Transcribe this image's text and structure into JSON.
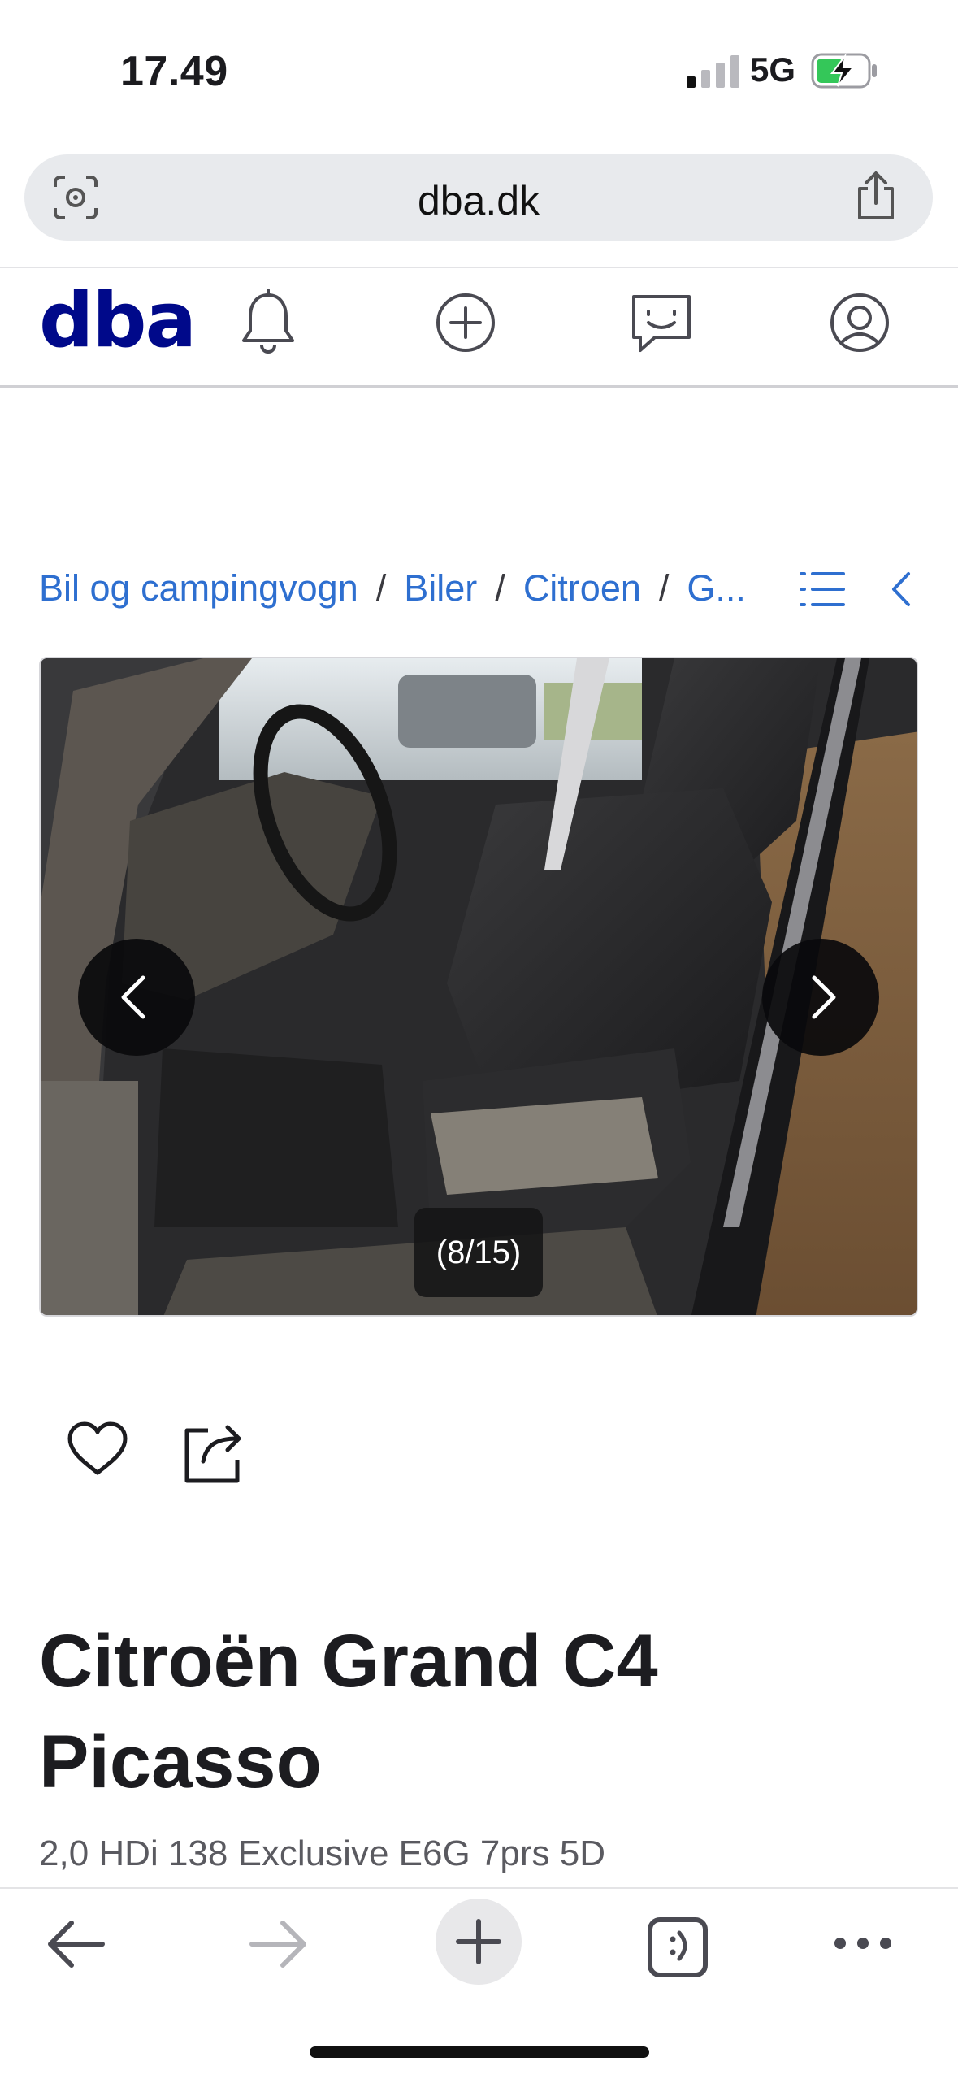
{
  "status_bar": {
    "time": "17.49",
    "network": "5G"
  },
  "browser": {
    "url": "dba.dk"
  },
  "nav": {
    "logo": "dba"
  },
  "breadcrumbs": {
    "items": [
      "Bil og campingvogn",
      "Biler",
      "Citroen",
      "G..."
    ],
    "separator": "/"
  },
  "gallery": {
    "counter": "(8/15)"
  },
  "listing": {
    "title": "Citroën Grand C4 Picasso",
    "subtitle": "2,0 HDi 138 Exclusive E6G 7prs 5D"
  },
  "colors": {
    "brand": "#00098a",
    "link": "#2e6fd0",
    "battery_charge": "#34c759"
  }
}
